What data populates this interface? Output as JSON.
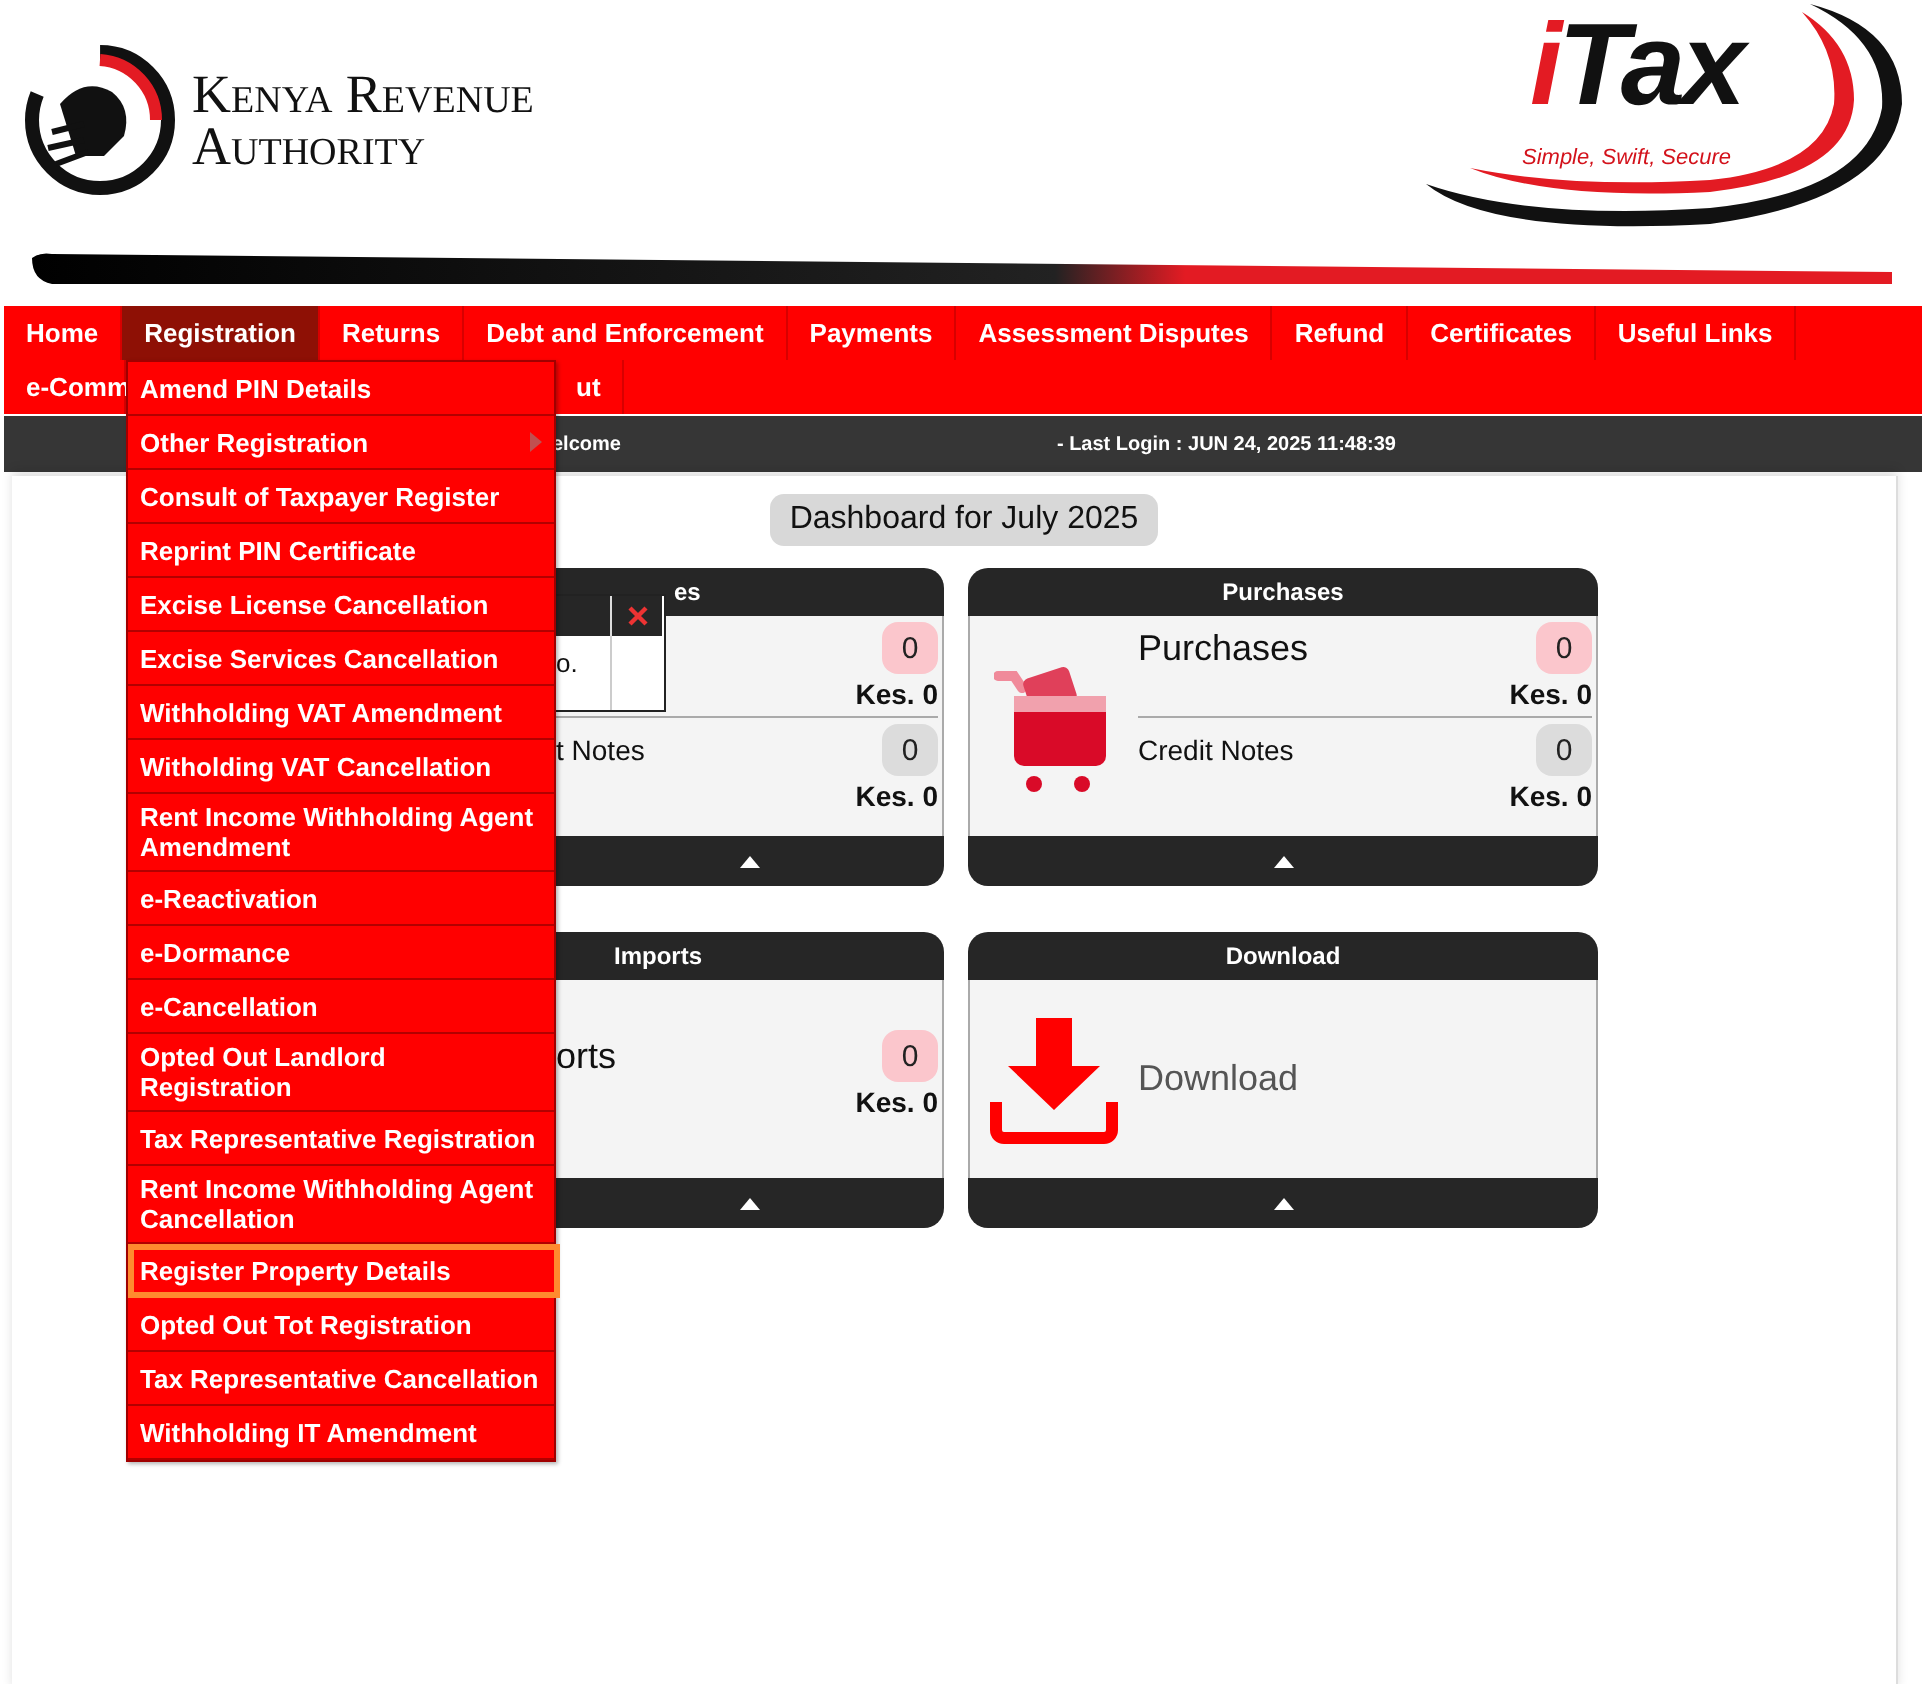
{
  "header": {
    "org_name": "Kenya Revenue Authority",
    "app_logo": "iTax",
    "tagline": "Simple, Swift, Secure"
  },
  "nav": {
    "row_1": [
      {
        "label": "Home",
        "selected": false
      },
      {
        "label": "Registration",
        "selected": true
      },
      {
        "label": "Returns",
        "selected": false
      },
      {
        "label": "Debt and Enforcement",
        "selected": false
      },
      {
        "label": "Payments",
        "selected": false
      },
      {
        "label": "Assessment Disputes",
        "selected": false
      },
      {
        "label": "Refund",
        "selected": false
      },
      {
        "label": "Certificates",
        "selected": false
      },
      {
        "label": "Useful Links",
        "selected": false
      }
    ],
    "row_2": [
      {
        "label": "e-Comm",
        "selected": false
      },
      {
        "label": "ut",
        "selected": false
      }
    ]
  },
  "dropdown": {
    "items": [
      {
        "label": "Amend PIN Details",
        "selected": false,
        "has_submenu": false
      },
      {
        "label": "Other Registration",
        "selected": false,
        "has_submenu": true
      },
      {
        "label": "Consult of Taxpayer Register",
        "selected": false,
        "has_submenu": false
      },
      {
        "label": "Reprint PIN Certificate",
        "selected": false,
        "has_submenu": false
      },
      {
        "label": "Excise License Cancellation",
        "selected": false,
        "has_submenu": false
      },
      {
        "label": "Excise Services Cancellation",
        "selected": false,
        "has_submenu": false
      },
      {
        "label": "Withholding VAT Amendment",
        "selected": false,
        "has_submenu": false
      },
      {
        "label": "Witholding VAT Cancellation",
        "selected": false,
        "has_submenu": false
      },
      {
        "label": "Rent Income Withholding Agent Amendment",
        "selected": false,
        "has_submenu": false
      },
      {
        "label": "e-Reactivation",
        "selected": false,
        "has_submenu": false
      },
      {
        "label": "e-Dormance",
        "selected": false,
        "has_submenu": false
      },
      {
        "label": "e-Cancellation",
        "selected": false,
        "has_submenu": false
      },
      {
        "label": "Opted Out Landlord Registration",
        "selected": false,
        "has_submenu": false
      },
      {
        "label": "Tax Representative Registration",
        "selected": false,
        "has_submenu": false
      },
      {
        "label": "Rent Income Withholding Agent Cancellation",
        "selected": false,
        "has_submenu": false
      },
      {
        "label": "Register Property Details",
        "selected": true,
        "has_submenu": false
      },
      {
        "label": "Opted Out Tot Registration",
        "selected": false,
        "has_submenu": false
      },
      {
        "label": "Tax Representative Cancellation",
        "selected": false,
        "has_submenu": false
      },
      {
        "label": "Withholding IT Amendment",
        "selected": false,
        "has_submenu": false
      }
    ]
  },
  "info_bar": {
    "welcome": "elcome",
    "last_login": "- Last Login : JUN 24, 2025 11:48:39"
  },
  "dashboard": {
    "title": "Dashboard for July 2025",
    "cards": [
      {
        "kind": "partial",
        "title": "es",
        "popup": {
          "text": "o."
        },
        "rows": [
          {
            "kind": "main",
            "count": "0",
            "amount": "Kes. 0"
          },
          {
            "kind": "credit",
            "label": "t Notes",
            "count": "0",
            "amount": "Kes. 0"
          }
        ]
      },
      {
        "kind": "cart",
        "title": "Purchases",
        "rows": [
          {
            "kind": "main",
            "label": "Purchases",
            "count": "0",
            "amount": "Kes. 0"
          },
          {
            "kind": "credit",
            "label": "Credit Notes",
            "count": "0",
            "amount": "Kes. 0"
          }
        ]
      },
      {
        "kind": "partial",
        "title": "Imports",
        "rows": [
          {
            "kind": "main",
            "label": "orts",
            "count": "0",
            "amount": "Kes. 0"
          }
        ]
      },
      {
        "kind": "download",
        "title": "Download",
        "link": "Download"
      }
    ]
  }
}
